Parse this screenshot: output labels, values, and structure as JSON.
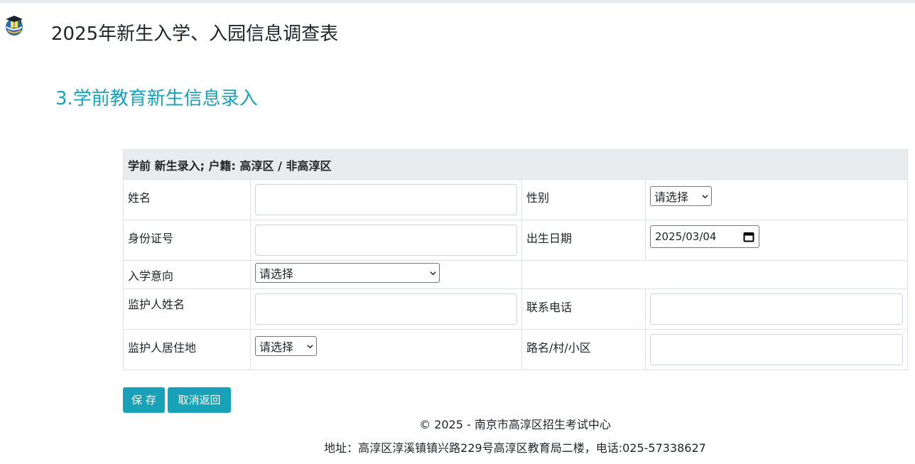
{
  "app": {
    "title": "2025年新生入学、入园信息调查表",
    "logo_icon": "school-globe-logo"
  },
  "section": {
    "title": "3.学前教育新生信息录入"
  },
  "form": {
    "header": "学前 新生录入; 户籍: 高淳区 / 非高淳区",
    "name_label": "姓名",
    "name_value": "",
    "gender_label": "性别",
    "gender_selected": "请选择",
    "id_label": "身份证号",
    "id_value": "",
    "birth_label": "出生日期",
    "birth_value": "2025/03/04",
    "intent_label": "入学意向",
    "intent_selected": "请选择",
    "guardian_name_label": "监护人姓名",
    "guardian_name_value": "",
    "phone_label": "联系电话",
    "phone_value": "",
    "residence_label": "监护人居住地",
    "residence_selected": "请选择",
    "road_label": "路名/村/小区",
    "road_value": ""
  },
  "buttons": {
    "save": "保 存",
    "cancel": "取消返回"
  },
  "footer": {
    "copyright": "© 2025 - 南京市高淳区招生考试中心",
    "address": "地址：高淳区淳溪镇镇兴路229号高淳区教育局二楼，电话:025-57338627"
  },
  "colors": {
    "accent": "#17a2b8",
    "table_header_bg": "#e9ecef",
    "border": "#dee2e6"
  }
}
